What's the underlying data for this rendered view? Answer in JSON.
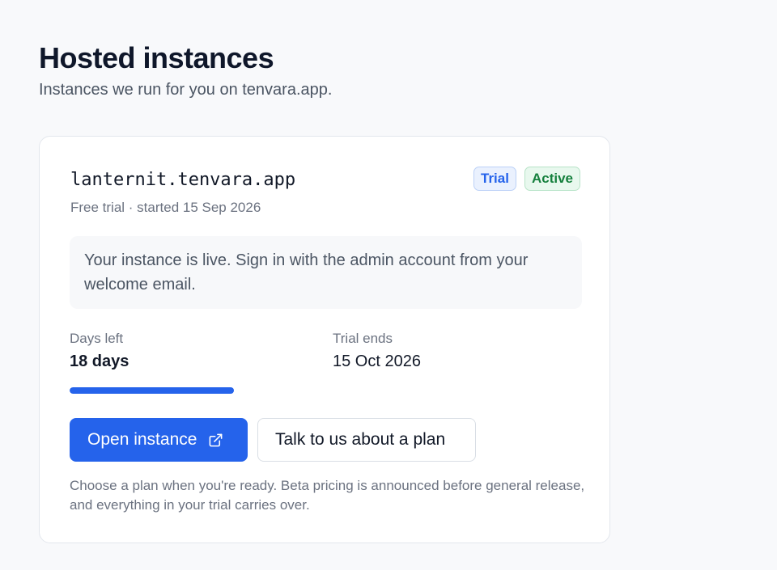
{
  "header": {
    "title": "Hosted instances",
    "subtitle": "Instances we run for you on tenvara.app."
  },
  "instance": {
    "hostname": "lanternit.tenvara.app",
    "meta": "Free trial · started 15 Sep 2026",
    "badges": {
      "trial": "Trial",
      "active": "Active"
    },
    "notice": "Your instance is live. Sign in with the admin account from your welcome email.",
    "days_left": {
      "label": "Days left",
      "value": "18 days"
    },
    "trial_ends": {
      "label": "Trial ends",
      "value": "15 Oct 2026"
    },
    "progress_fraction": 0.4,
    "actions": {
      "open_label": "Open instance",
      "open_icon": "external-link-icon",
      "plan_label": "Talk to us about a plan"
    },
    "footnote": "Choose a plan when you're ready. Beta pricing is announced before general release, and everything in your trial carries over."
  },
  "colors": {
    "accent": "#2563eb",
    "trial_badge_text": "#2563eb",
    "active_badge_text": "#15803d",
    "background": "#f8f9fb"
  }
}
